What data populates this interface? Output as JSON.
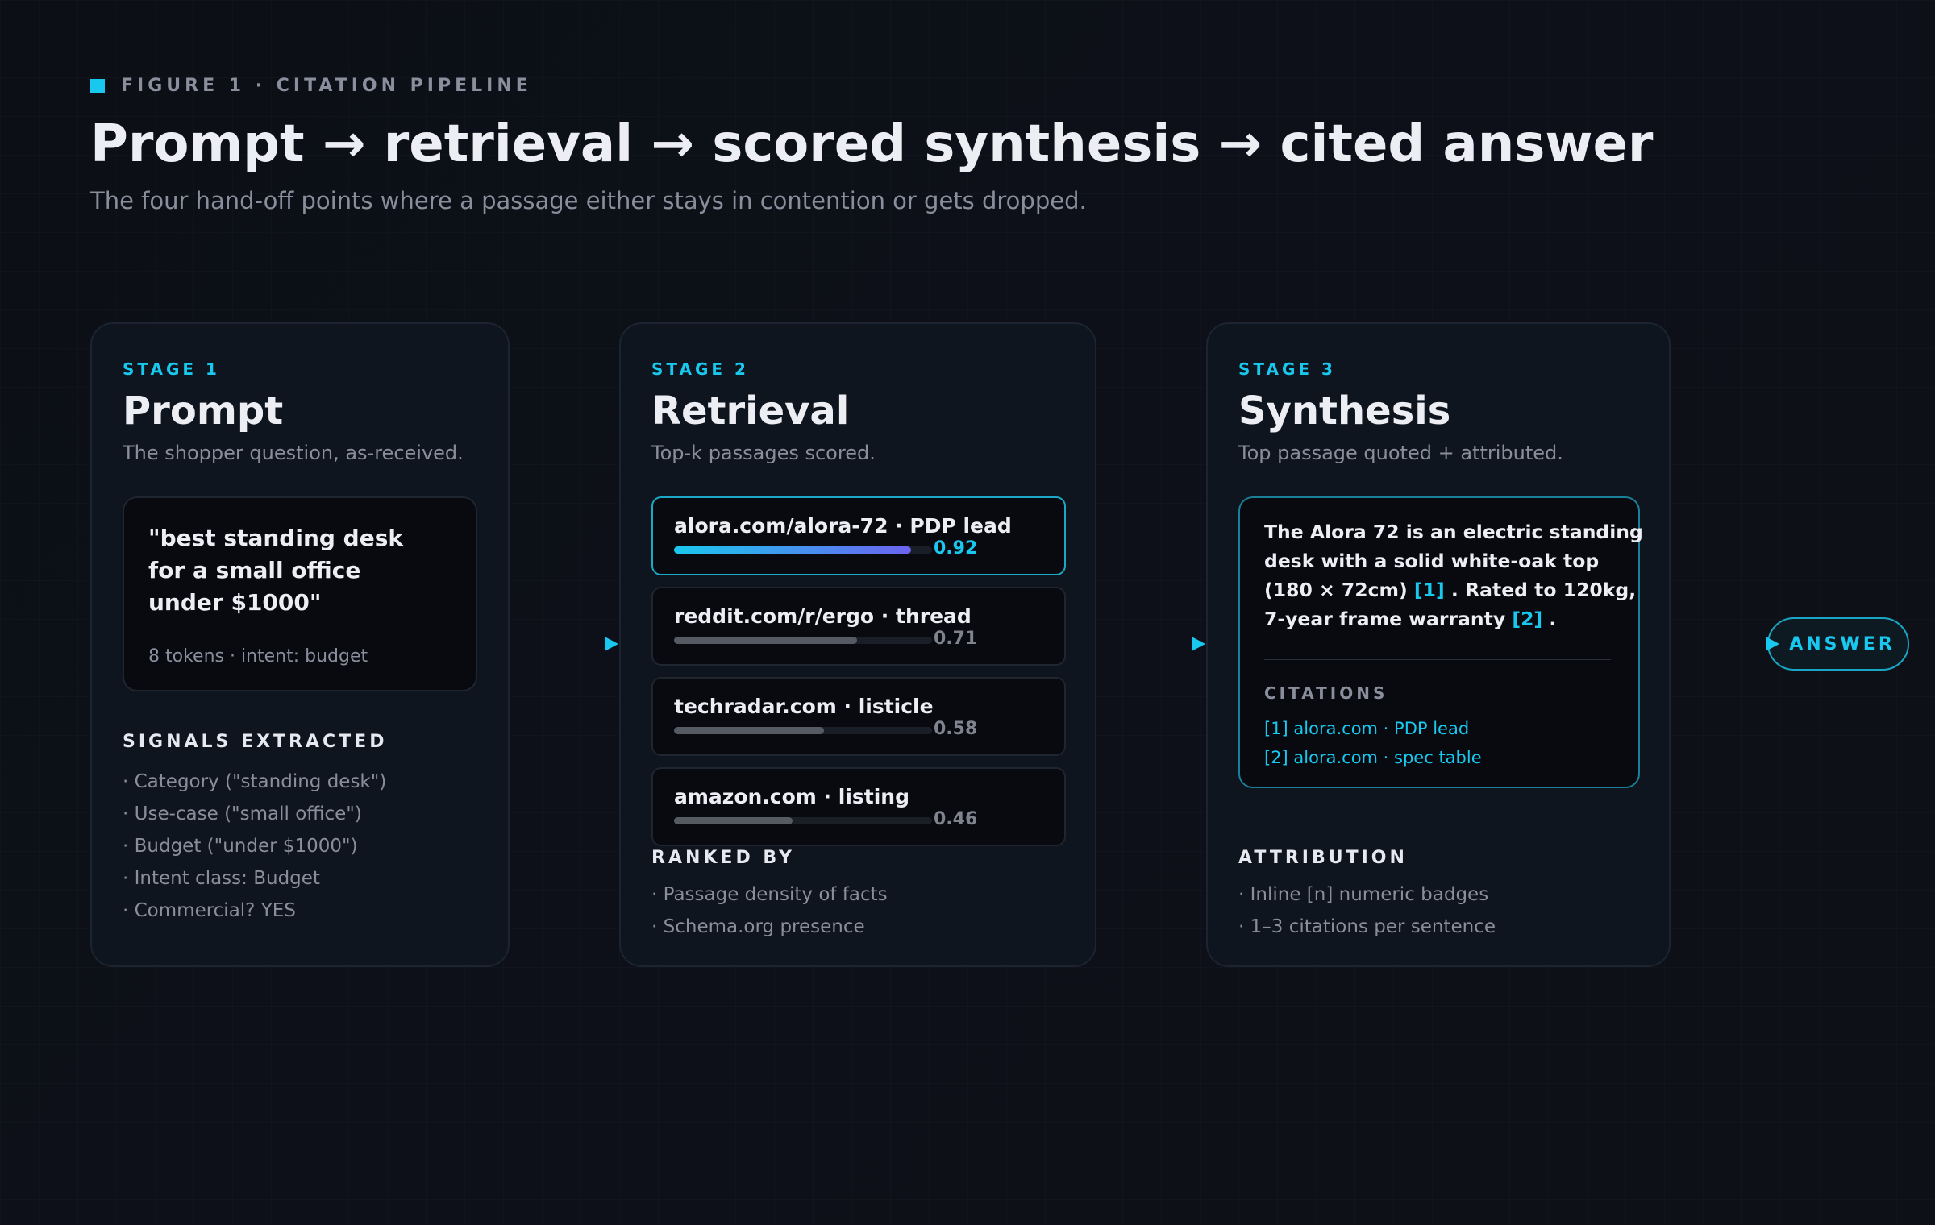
{
  "header": {
    "eyebrow": "FIGURE 1 · CITATION PIPELINE",
    "title": "Prompt → retrieval → scored synthesis → cited answer",
    "subtitle": "The four hand-off points where a passage either stays in contention or gets dropped."
  },
  "accent_color": "#19c8ee",
  "stages": [
    {
      "stage": "STAGE 1",
      "title": "Prompt",
      "desc": "The shopper question, as-received.",
      "query_lines": [
        "\"best standing desk",
        "for a small office",
        "under $1000\""
      ],
      "query_meta": "8 tokens · intent: budget",
      "section_title": "SIGNALS EXTRACTED",
      "items": [
        "· Category (\"standing desk\")",
        "· Use-case (\"small office\")",
        "· Budget (\"under $1000\")",
        "· Intent class: Budget",
        "· Commercial? YES"
      ]
    },
    {
      "stage": "STAGE 2",
      "title": "Retrieval",
      "desc": "Top-k passages scored.",
      "passages": [
        {
          "name": "alora.com/alora-72 · PDP lead",
          "score": 0.92,
          "score_label": "0.92"
        },
        {
          "name": "reddit.com/r/ergo · thread",
          "score": 0.71,
          "score_label": "0.71"
        },
        {
          "name": "techradar.com · listicle",
          "score": 0.58,
          "score_label": "0.58"
        },
        {
          "name": "amazon.com · listing",
          "score": 0.46,
          "score_label": "0.46"
        }
      ],
      "section_title": "RANKED BY",
      "items": [
        "· Passage density of facts",
        "· Schema.org presence"
      ]
    },
    {
      "stage": "STAGE 3",
      "title": "Synthesis",
      "desc": "Top passage quoted + attributed.",
      "answer": {
        "l1": "The Alora 72 is an electric standing",
        "l2": "desk with a solid white-oak top",
        "l3a": "(180 × 72cm) ",
        "l3b": "[1]",
        "l3c": " . Rated to 120kg,",
        "l4a": "7-year frame warranty ",
        "l4b": "[2]",
        "l4c": " ."
      },
      "citations_title": "CITATIONS",
      "citations": [
        "[1] alora.com · PDP lead",
        "[2] alora.com · spec table"
      ],
      "section_title": "ATTRIBUTION",
      "items": [
        "· Inline [n] numeric badges",
        "· 1–3 citations per sentence"
      ]
    }
  ],
  "answer_label": "ANSWER"
}
